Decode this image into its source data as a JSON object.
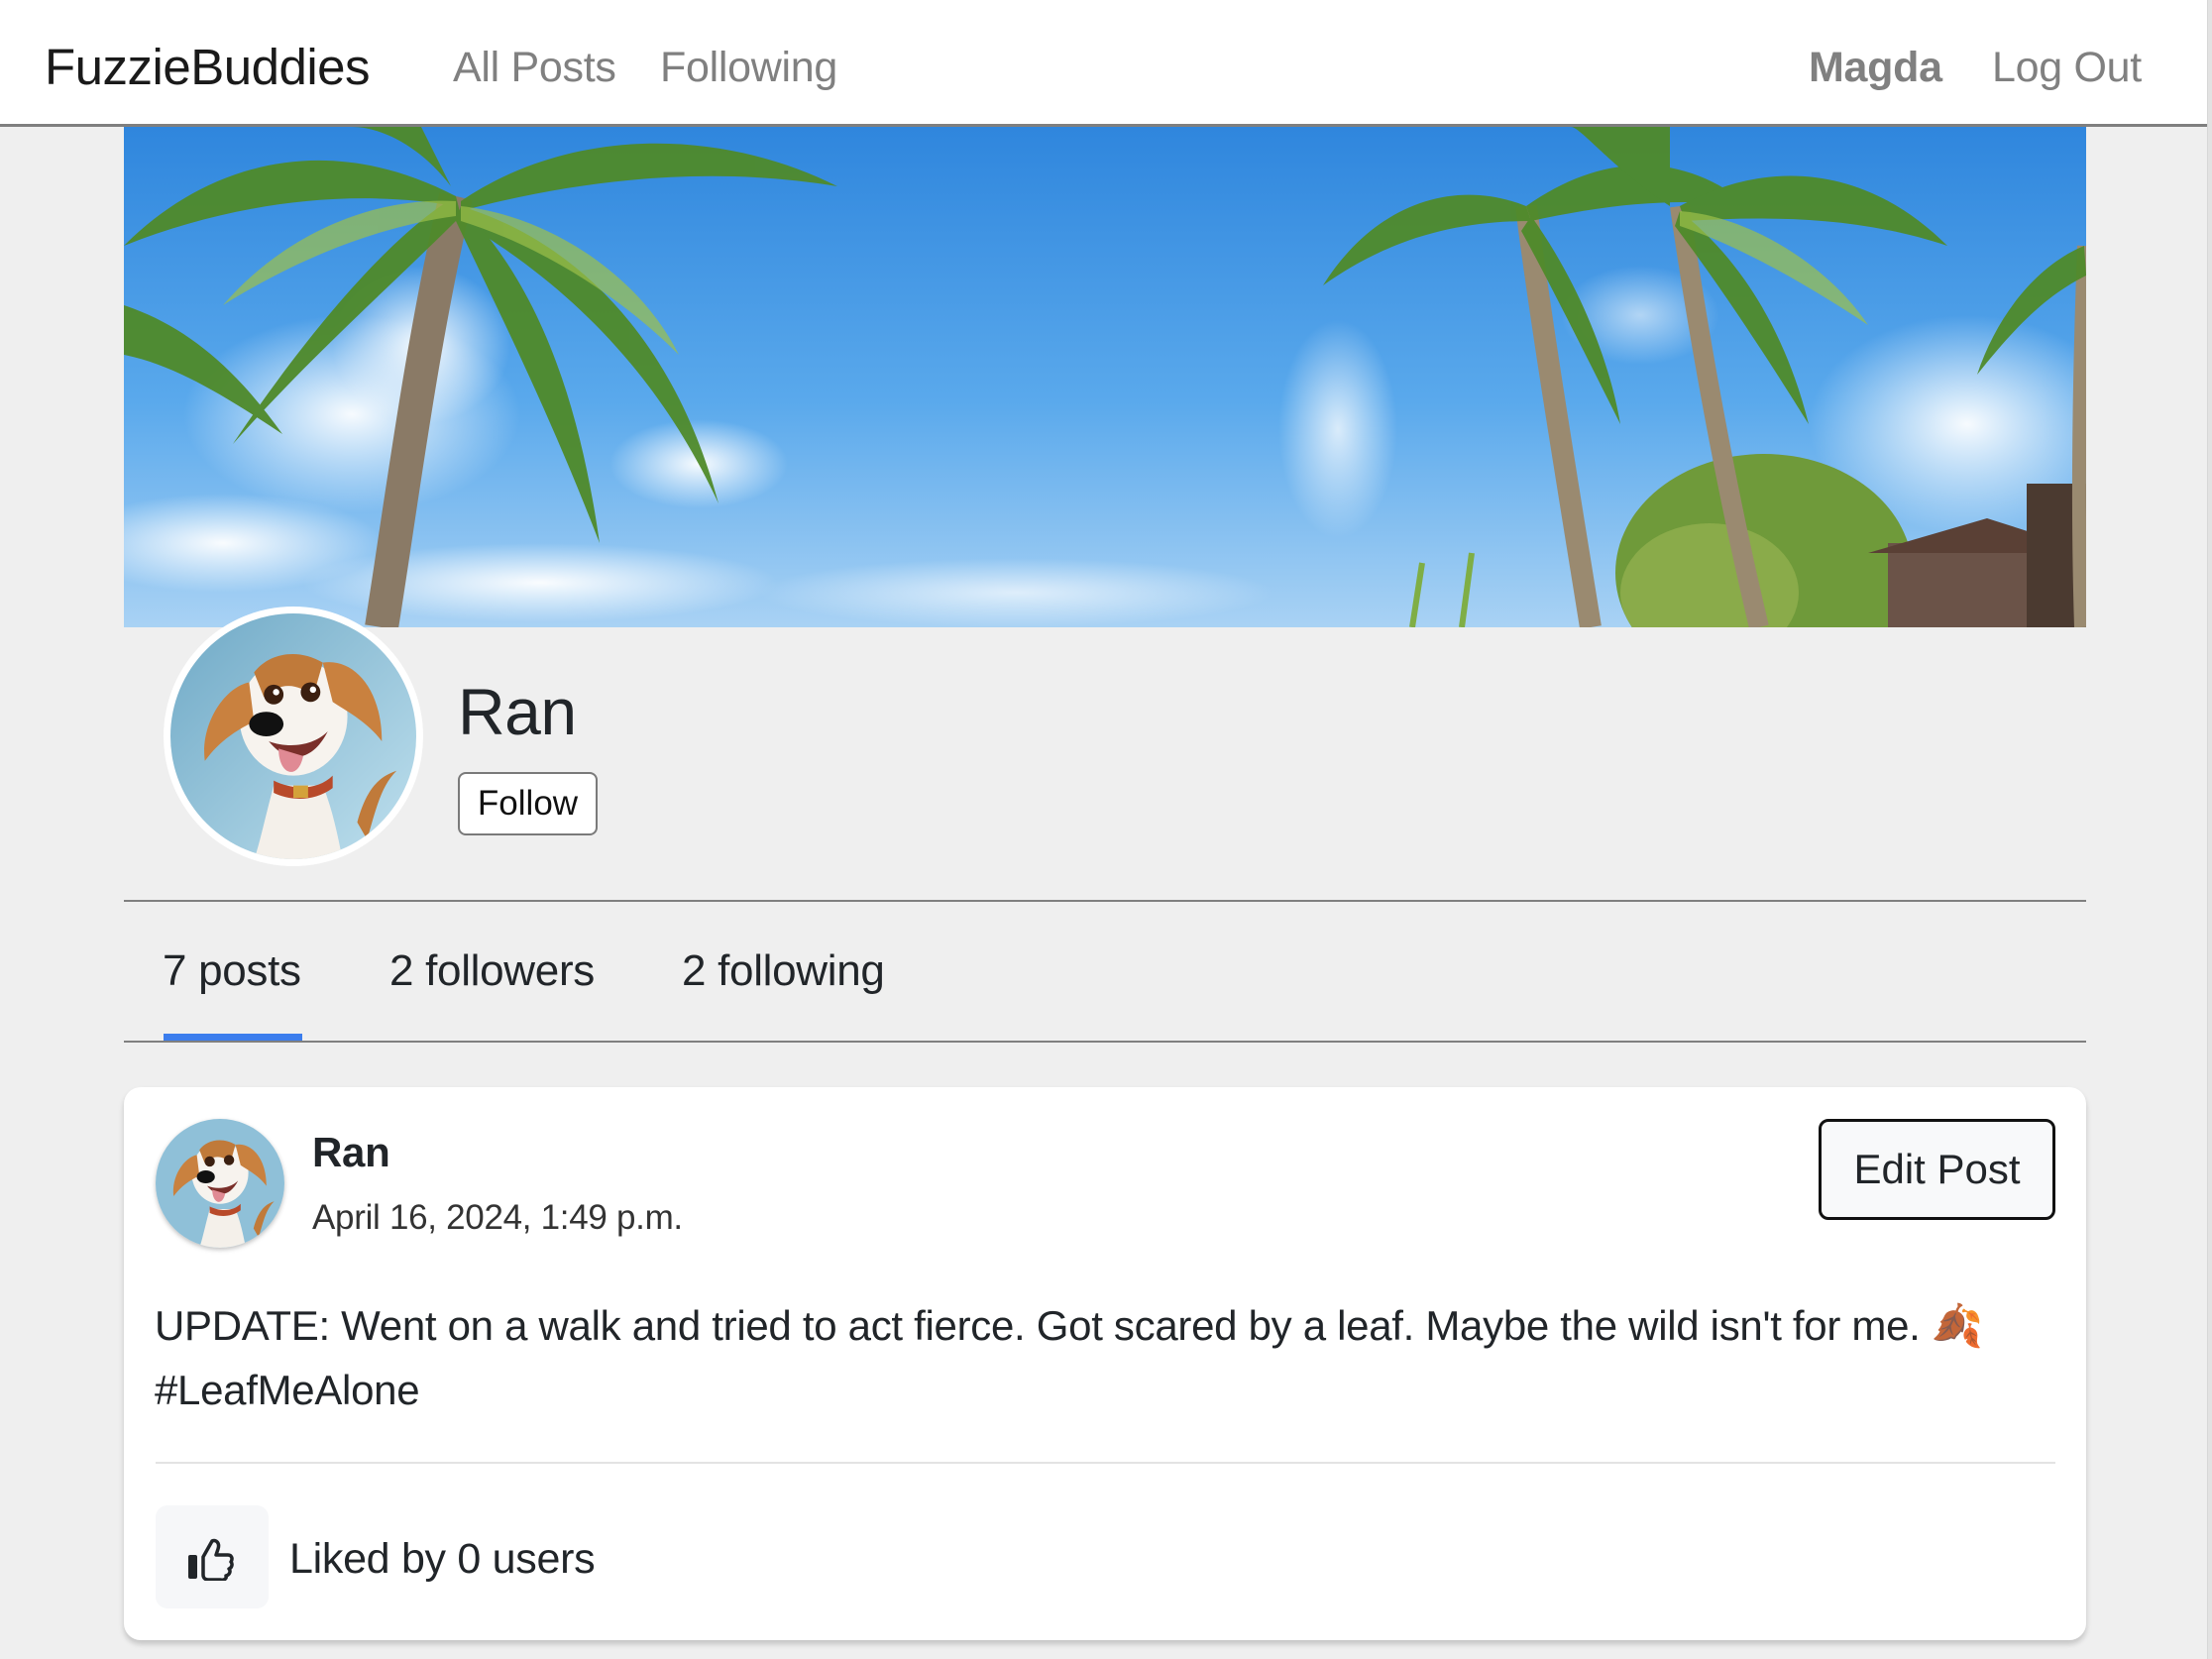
{
  "navbar": {
    "brand": "FuzzieBuddies",
    "links": [
      {
        "label": "All Posts"
      },
      {
        "label": "Following"
      }
    ],
    "user": "Magda",
    "logout": "Log Out"
  },
  "profile": {
    "banner_icon": "tropical-palm-beach-banner",
    "avatar_icon": "cartoon-dog-avatar",
    "name": "Ran",
    "follow_label": "Follow"
  },
  "tabs": {
    "active": 0,
    "items": [
      {
        "label": "7 posts"
      },
      {
        "label": "2 followers"
      },
      {
        "label": "2 following"
      }
    ],
    "accent_color": "#3b7ded"
  },
  "posts": [
    {
      "author": "Ran",
      "date": "April 16, 2024, 1:49 p.m.",
      "edit_label": "Edit Post",
      "body": "UPDATE: Went on a walk and tried to act fierce. Got scared by a leaf. Maybe the wild isn't for me. 🍂 #LeafMeAlone",
      "like_icon": "thumbs-up-icon",
      "likes_text": "Liked by 0 users"
    }
  ]
}
